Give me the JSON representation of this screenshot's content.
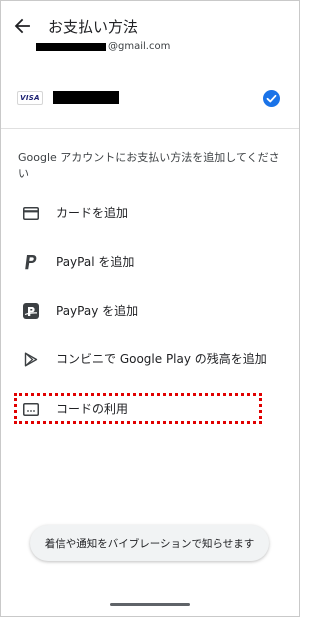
{
  "header": {
    "back_icon": "arrow-left-icon",
    "title": "お支払い方法",
    "account_suffix": "@gmail.com"
  },
  "payment_card": {
    "brand": "VISA",
    "selected": true,
    "check_color": "#1a73e8"
  },
  "prompt": "Google アカウントにお支払い方法を追加してください",
  "options": [
    {
      "icon": "credit-card-icon",
      "label": "カードを追加"
    },
    {
      "icon": "paypal-icon",
      "label": "PayPal を追加"
    },
    {
      "icon": "paypay-icon",
      "label": "PayPay を追加"
    },
    {
      "icon": "google-play-icon",
      "label": "コンビニで Google Play の残高を追加"
    },
    {
      "icon": "code-redeem-icon",
      "label": "コードの利用",
      "highlighted": true
    }
  ],
  "highlight_color": "#e00000",
  "toast": "着信や通知をバイブレーションで知らせます"
}
